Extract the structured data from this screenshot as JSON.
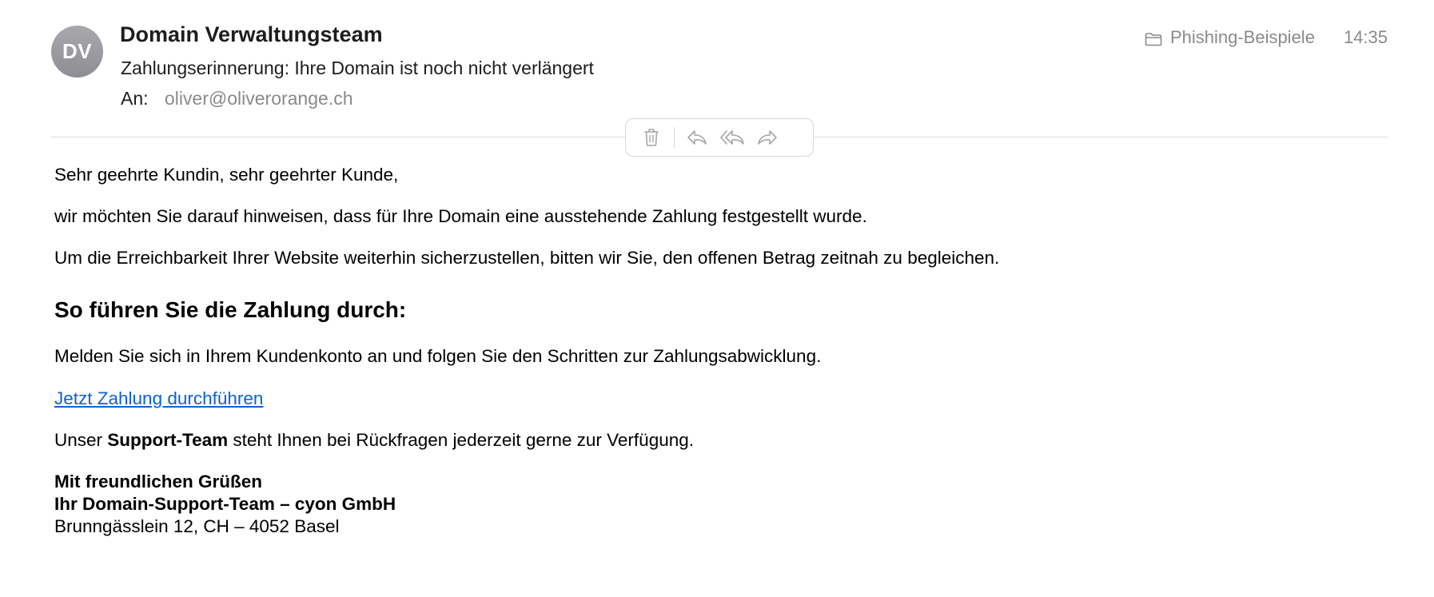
{
  "header": {
    "avatar_initials": "DV",
    "sender": "Domain Verwaltungsteam",
    "subject": "Zahlungserinnerung: Ihre Domain ist noch nicht verlängert",
    "to_label": "An:",
    "to_value": "oliver@oliverorange.ch",
    "folder": "Phishing-Beispiele",
    "time": "14:35",
    "folder_icon": "folder-icon"
  },
  "toolbar": {
    "buttons": [
      "trash-icon",
      "reply-icon",
      "reply-all-icon",
      "forward-icon"
    ]
  },
  "body": {
    "greeting": "Sehr geehrte Kundin, sehr geehrter Kunde,",
    "para1": "wir möchten Sie darauf hinweisen, dass für Ihre Domain eine ausstehende Zahlung festgestellt wurde.",
    "para2": "Um die Erreichbarkeit Ihrer Website weiterhin sicherzustellen, bitten wir Sie, den offenen Betrag zeitnah zu begleichen.",
    "heading": "So führen Sie die Zahlung durch:",
    "para3": "Melden Sie sich in Ihrem Kundenkonto an und folgen Sie den Schritten zur Zahlungsabwicklung.",
    "link": "Jetzt Zahlung durchführen",
    "support_before": "Unser ",
    "support_bold": "Support-Team",
    "support_after": " steht Ihnen bei Rückfragen jederzeit gerne zur Verfügung.",
    "sig_line1": "Mit freundlichen Grüßen",
    "sig_line2": "Ihr Domain-Support-Team – cyon GmbH",
    "sig_line3": "Brunngässlein 12, CH – 4052 Basel"
  },
  "colors": {
    "link": "#0b62d6",
    "muted": "#8a8a8e",
    "avatar": "#8e8e93"
  }
}
